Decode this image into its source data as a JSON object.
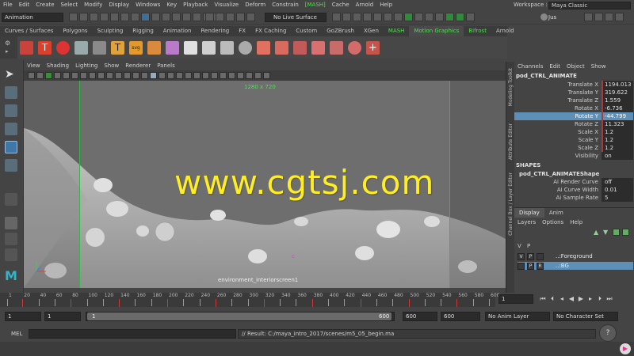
{
  "menubar": {
    "items": [
      "File",
      "Edit",
      "Create",
      "Select",
      "Modify",
      "Display",
      "Windows",
      "Key",
      "Playback",
      "Visualize",
      "Deform",
      "Constrain",
      "[MASH]",
      "Cache",
      "Arnold",
      "Help"
    ],
    "workspace_label": "Workspace :",
    "workspace_value": "Maya Classic"
  },
  "statusline": {
    "mode": "Animation",
    "live_surface": "No Live Surface",
    "user": "Jus"
  },
  "shelf": {
    "tabs": [
      "Curves / Surfaces",
      "Polygons",
      "Sculpting",
      "Rigging",
      "Animation",
      "Rendering",
      "FX",
      "FX Caching",
      "Custom",
      "GoZBrush",
      "XGen",
      "MASH",
      "Motion Graphics",
      "Bifrost",
      "Arnold"
    ]
  },
  "viewport": {
    "menu": [
      "View",
      "Shading",
      "Lighting",
      "Show",
      "Renderer",
      "Panels"
    ],
    "resolution": "1280 x 720",
    "camera": "environment_interiorscreen1",
    "watermark": "www.cgtsj.com",
    "marker": "c"
  },
  "side_tabs": [
    "Modeling Toolkit",
    "Attribute Editor",
    "Channel Box / Layer Editor"
  ],
  "channelbox": {
    "menu": [
      "Channels",
      "Edit",
      "Object",
      "Show"
    ],
    "object": "pod_CTRL_ANIMATE",
    "attributes": [
      {
        "name": "Translate X",
        "value": "1194.013"
      },
      {
        "name": "Translate Y",
        "value": "319.622"
      },
      {
        "name": "Translate Z",
        "value": "1.559"
      },
      {
        "name": "Rotate X",
        "value": "-6.736"
      },
      {
        "name": "Rotate Y",
        "value": "-44.799"
      },
      {
        "name": "Rotate Z",
        "value": "11.323"
      },
      {
        "name": "Scale X",
        "value": "1.2"
      },
      {
        "name": "Scale Y",
        "value": "1.2"
      },
      {
        "name": "Scale Z",
        "value": "1.2"
      },
      {
        "name": "Visibility",
        "value": "on"
      }
    ],
    "shapes_label": "SHAPES",
    "shape_name": "pod_CTRL_ANIMATEShape",
    "shape_attributes": [
      {
        "name": "Ai Render Curve",
        "value": "off"
      },
      {
        "name": "Ai Curve Width",
        "value": "0.01"
      },
      {
        "name": "Ai Sample Rate",
        "value": "5"
      }
    ]
  },
  "layer_editor": {
    "tabs": [
      "Display",
      "Anim"
    ],
    "menu": [
      "Layers",
      "Options",
      "Help"
    ],
    "header_v": "V",
    "header_p": "P",
    "layers": [
      {
        "v": "V",
        "p": "P",
        "r": "",
        "name": "..:Foreground"
      },
      {
        "v": "",
        "p": "P",
        "r": "R",
        "name": "..:BG"
      }
    ]
  },
  "timeline": {
    "ticks": [
      "1",
      "20",
      "40",
      "60",
      "80",
      "100",
      "120",
      "140",
      "160",
      "180",
      "200",
      "220",
      "240",
      "260",
      "280",
      "300",
      "320",
      "340",
      "360",
      "380",
      "400",
      "420",
      "440",
      "460",
      "480",
      "500",
      "520",
      "540",
      "560",
      "580",
      "600"
    ],
    "current_frame": "1"
  },
  "range": {
    "start": "1",
    "anim_start": "1",
    "handle_start": "1",
    "handle_end": "600",
    "anim_end": "600",
    "end": "600",
    "anim_layer": "No Anim Layer",
    "character_set": "No Character Set"
  },
  "cmdline": {
    "mel": "MEL",
    "result": "// Result: C:/maya_intro_2017/scenes/m5_05_begin.ma"
  },
  "colors": {
    "accent_green": "#4fdf4f",
    "selection_blue": "#5d8fb7",
    "watermark_yellow": "#ffee22"
  }
}
